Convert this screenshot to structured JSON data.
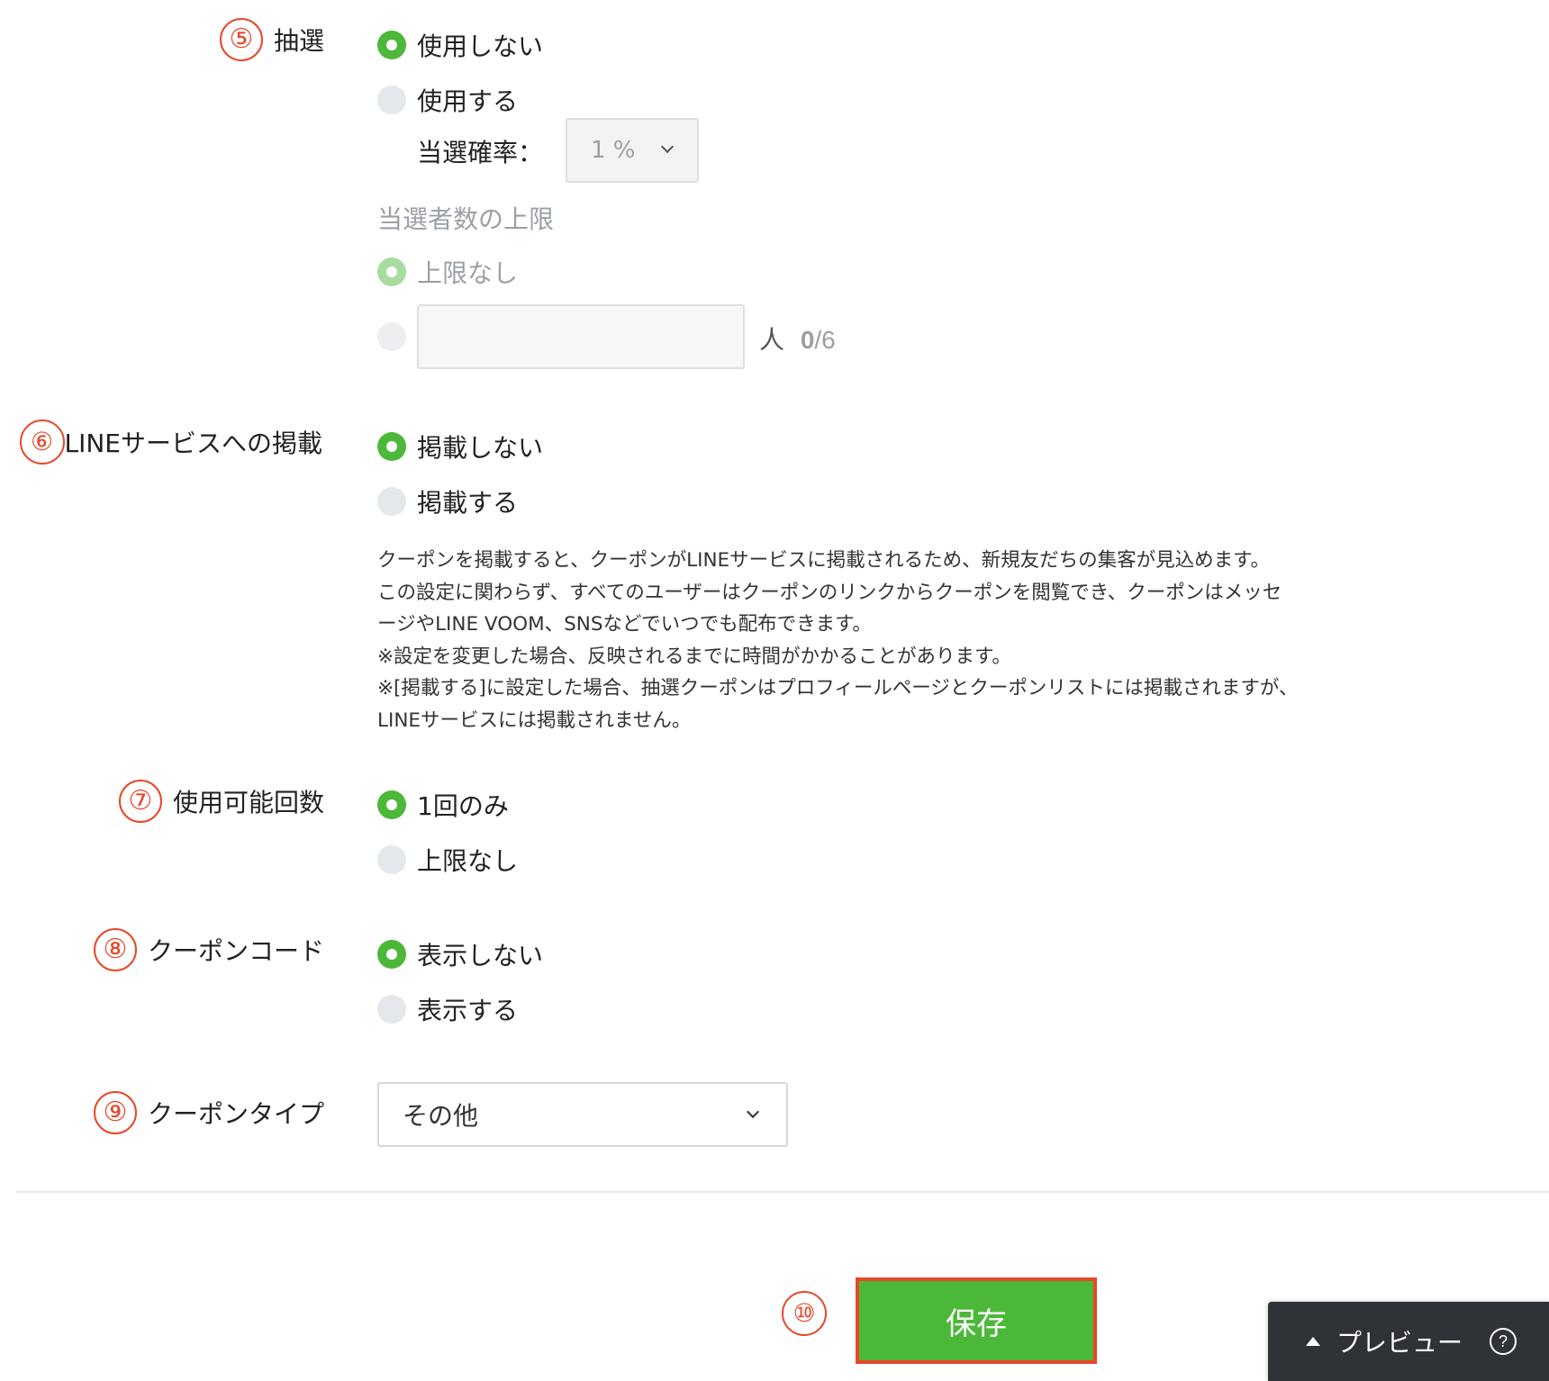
{
  "lottery": {
    "badge": "⑤",
    "label": "抽選",
    "option_off": "使用しない",
    "option_on": "使用する",
    "probability_label": "当選確率：",
    "probability_value": "1 %",
    "winner_limit_label": "当選者数の上限",
    "limit_none": "上限なし",
    "person_unit": "人",
    "count_current": "0",
    "count_max": "/6"
  },
  "line_service": {
    "badge": "⑥",
    "label": "LINEサービスへの掲載",
    "option_off": "掲載しない",
    "option_on": "掲載する",
    "description": [
      "クーポンを掲載すると、クーポンがLINEサービスに掲載されるため、新規友だちの集客が見込めます。",
      "この設定に関わらず、すべてのユーザーはクーポンのリンクからクーポンを閲覧でき、クーポンはメッセ",
      "ージやLINE VOOM、SNSなどでいつでも配布できます。",
      "※設定を変更した場合、反映されるまでに時間がかかることがあります。",
      "※[掲載する]に設定した場合、抽選クーポンはプロフィールページとクーポンリストには掲載されますが、",
      "LINEサービスには掲載されません。"
    ]
  },
  "usage_count": {
    "badge": "⑦",
    "label": "使用可能回数",
    "option_once": "1回のみ",
    "option_unlimited": "上限なし"
  },
  "coupon_code": {
    "badge": "⑧",
    "label": "クーポンコード",
    "option_hide": "表示しない",
    "option_show": "表示する"
  },
  "coupon_type": {
    "badge": "⑨",
    "label": "クーポンタイプ",
    "selected": "その他"
  },
  "footer": {
    "badge": "⑩",
    "save_label": "保存",
    "preview_label": "プレビュー",
    "help_glyph": "?"
  },
  "colors": {
    "accent_green": "#4cb839",
    "annotation_red": "#e8462a"
  }
}
